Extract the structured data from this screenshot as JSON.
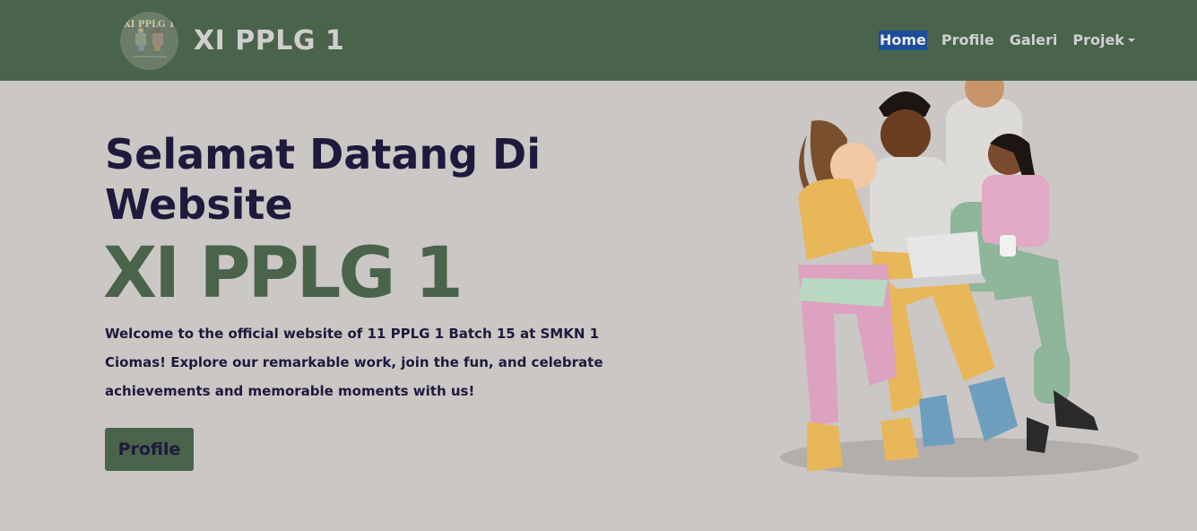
{
  "navbar": {
    "brand": {
      "logo_text": "XI PPLG 1",
      "logo_subtext": "A place to explore coding",
      "title": "XI PPLG 1"
    },
    "links": [
      {
        "label": "Home",
        "active": true
      },
      {
        "label": "Profile"
      },
      {
        "label": "Galeri"
      },
      {
        "label": "Projek",
        "dropdown": true
      }
    ]
  },
  "hero": {
    "heading": "Selamat Datang Di Website",
    "brand_text": "XI PPLG 1",
    "description": "Welcome to the official website of 11 PPLG 1 Batch 15 at SMKN 1 Ciomas! Explore our remarkable work, join the fun, and celebrate achievements and memorable moments with us!",
    "cta_label": "Profile",
    "illustration_icon": "students-group-illustration"
  },
  "colors": {
    "navbar_bg": "#4a634b",
    "page_bg": "#cbc7c5",
    "heading_text": "#1e1a3c",
    "accent": "#4a634b",
    "active_link_bg": "#1e4d9a"
  }
}
